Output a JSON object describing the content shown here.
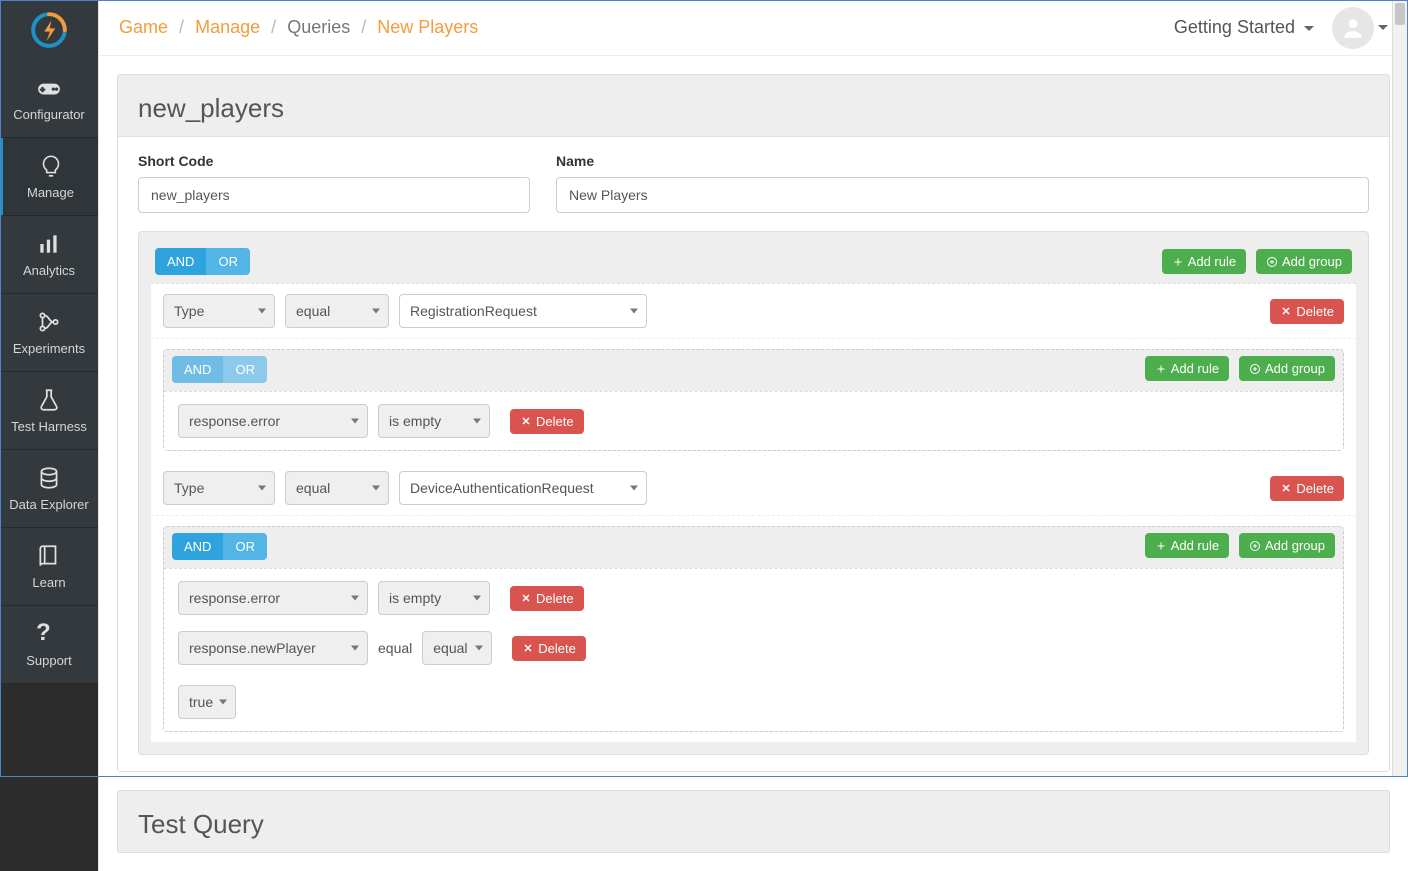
{
  "sidebar": {
    "items": [
      {
        "label": "Configurator"
      },
      {
        "label": "Manage"
      },
      {
        "label": "Analytics"
      },
      {
        "label": "Experiments"
      },
      {
        "label": "Test Harness"
      },
      {
        "label": "Data Explorer"
      },
      {
        "label": "Learn"
      },
      {
        "label": "Support"
      }
    ]
  },
  "breadcrumb": {
    "game": "Game",
    "manage": "Manage",
    "queries": "Queries",
    "current": "New Players"
  },
  "topRight": {
    "gettingStarted": "Getting Started"
  },
  "panel": {
    "title": "new_players",
    "fields": {
      "shortCodeLabel": "Short Code",
      "shortCodeValue": "new_players",
      "nameLabel": "Name",
      "nameValue": "New Players"
    }
  },
  "builder": {
    "andLabel": "AND",
    "orLabel": "OR",
    "addRule": "Add rule",
    "addGroup": "Add group",
    "delete": "Delete",
    "rules": [
      {
        "field": "Type",
        "op": "equal",
        "value": "RegistrationRequest",
        "sub": {
          "rules": [
            {
              "field": "response.error",
              "op": "is empty"
            }
          ]
        }
      },
      {
        "field": "Type",
        "op": "equal",
        "value": "DeviceAuthenticationRequest",
        "sub": {
          "rules": [
            {
              "field": "response.error",
              "op": "is empty"
            },
            {
              "field": "response.newPlayer",
              "opLabel": "equal",
              "op": "equal",
              "value": "true"
            }
          ]
        }
      }
    ]
  },
  "testQuery": {
    "title": "Test Query"
  }
}
